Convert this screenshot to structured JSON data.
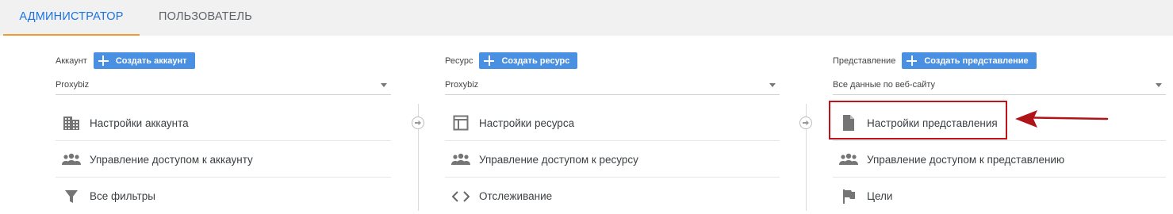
{
  "tabs": [
    {
      "label": "АДМИНИСТРАТОР",
      "active": true
    },
    {
      "label": "ПОЛЬЗОВАТЕЛЬ",
      "active": false
    }
  ],
  "columns": {
    "account": {
      "label": "Аккаунт",
      "create_button": "Создать аккаунт",
      "selected": "Proxybiz",
      "items": [
        {
          "label": "Настройки аккаунта",
          "icon": "building-icon"
        },
        {
          "label": "Управление доступом к аккаунту",
          "icon": "people-icon"
        },
        {
          "label": "Все фильтры",
          "icon": "filter-icon"
        }
      ]
    },
    "property": {
      "label": "Ресурс",
      "create_button": "Создать ресурс",
      "selected": "Proxybiz",
      "items": [
        {
          "label": "Настройки ресурса",
          "icon": "property-window-icon"
        },
        {
          "label": "Управление доступом к ресурсу",
          "icon": "people-icon"
        },
        {
          "label": "Отслеживание",
          "icon": "code-icon"
        }
      ]
    },
    "view": {
      "label": "Представление",
      "create_button": "Создать представление",
      "selected": "Все данные по веб-сайту",
      "items": [
        {
          "label": "Настройки представления",
          "icon": "document-icon"
        },
        {
          "label": "Управление доступом к представлению",
          "icon": "people-icon"
        },
        {
          "label": "Цели",
          "icon": "flag-icon"
        }
      ]
    }
  },
  "colors": {
    "accent": "#1a73e8",
    "tab_underline": "#f29a35",
    "button": "#4a90e2",
    "highlight": "#c0141b"
  }
}
